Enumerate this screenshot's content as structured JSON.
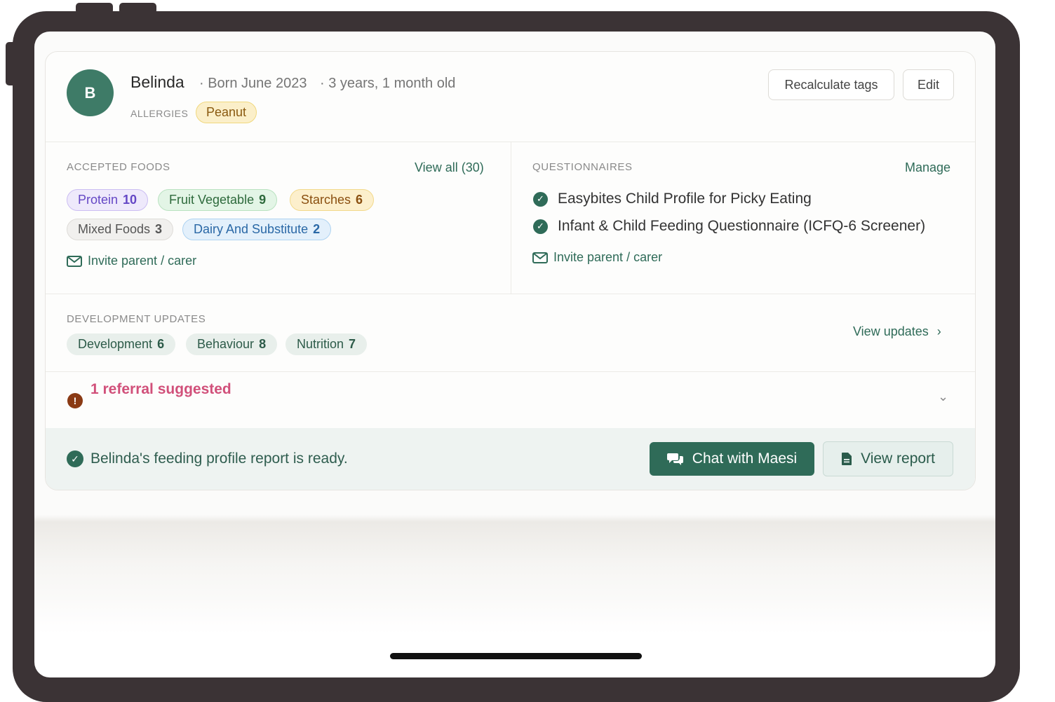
{
  "profile": {
    "avatar_initial": "B",
    "name": "Belinda",
    "born": "· Born June 2023",
    "age": "· 3 years, 1 month old",
    "allergies_label": "ALLERGIES",
    "allergies": [
      "Peanut"
    ]
  },
  "header_actions": {
    "recalculate_label": "Recalculate tags",
    "edit_label": "Edit"
  },
  "accepted_foods": {
    "label": "ACCEPTED FOODS",
    "view_all_label": "View all (30)",
    "categories": [
      {
        "name": "Protein",
        "count": "10",
        "color": "#6447c5"
      },
      {
        "name": "Fruit Vegetable",
        "count": "9",
        "color": "#2e6a3c"
      },
      {
        "name": "Starches",
        "count": "6",
        "color": "#8a4f10"
      },
      {
        "name": "Mixed Foods",
        "count": "3",
        "color": "#555555"
      },
      {
        "name": "Dairy And Substitute",
        "count": "2",
        "color": "#2a68a6"
      }
    ],
    "invite_label": "Invite parent / carer"
  },
  "questionnaires": {
    "label": "QUESTIONNAIRES",
    "manage_label": "Manage",
    "items": [
      "Easybites Child Profile for Picky Eating",
      "Infant & Child Feeding Questionnaire (ICFQ-6 Screener)"
    ],
    "invite_label": "Invite parent / carer"
  },
  "development_updates": {
    "label": "DEVELOPMENT UPDATES",
    "items": [
      {
        "name": "Development",
        "count": "6"
      },
      {
        "name": "Behaviour",
        "count": "8"
      },
      {
        "name": "Nutrition",
        "count": "7"
      }
    ],
    "view_updates_label": "View updates"
  },
  "referral": {
    "title": "1 referral suggested",
    "icon": "alert-icon"
  },
  "report": {
    "ready_text": "Belinda's feeding profile report is ready.",
    "chat_label": "Chat with Maesi",
    "view_report_label": "View report"
  },
  "colors": {
    "brand_green": "#2f6b58",
    "frame": "#3b3335",
    "referral_pink": "#d1507a"
  }
}
